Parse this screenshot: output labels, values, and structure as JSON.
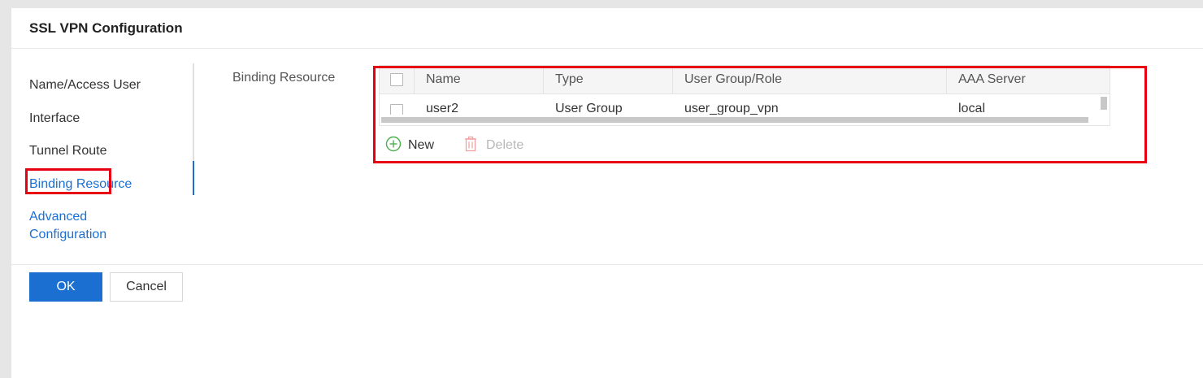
{
  "dialog": {
    "title": "SSL VPN Configuration"
  },
  "nav": {
    "items": [
      {
        "label": "Name/Access User"
      },
      {
        "label": "Interface"
      },
      {
        "label": "Tunnel Route"
      },
      {
        "label": "Binding Resource"
      },
      {
        "label": "Advanced Configuration"
      }
    ],
    "active": "Binding Resource"
  },
  "form": {
    "binding_resource_label": "Binding Resource",
    "table": {
      "columns": [
        "Name",
        "Type",
        "User Group/Role",
        "AAA Server"
      ],
      "rows": [
        {
          "name": "user2",
          "type": "User Group",
          "group_role": "user_group_vpn",
          "aaa_server": "local"
        }
      ]
    },
    "new_label": "New",
    "delete_label": "Delete"
  },
  "footer": {
    "ok_label": "OK",
    "cancel_label": "Cancel"
  },
  "colors": {
    "accent": "#1a6fd1",
    "highlight": "#e60012",
    "new_icon": "#4caf50",
    "delete_icon": "#f0a0a0"
  },
  "icons": {
    "new": "plus-circle-icon",
    "delete": "trash-icon"
  }
}
